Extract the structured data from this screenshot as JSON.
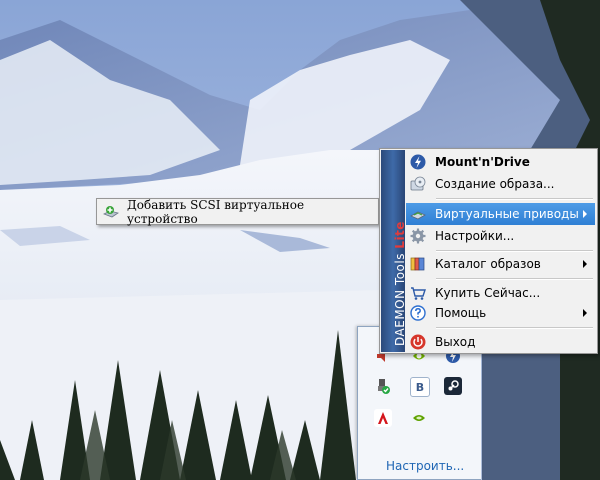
{
  "main_menu": {
    "banner": {
      "brand": "DAEMON Tools",
      "edition": "Lite"
    },
    "items": [
      {
        "label": "Mount'n'Drive",
        "icon": "lightning-icon",
        "bold": true
      },
      {
        "label": "Создание образа...",
        "icon": "disc-create-icon"
      },
      {
        "label": "Виртуальные приводы",
        "icon": "virtual-drive-icon",
        "highlighted": true,
        "submenu": true
      },
      {
        "label": "Настройки...",
        "icon": "gear-icon"
      },
      {
        "label": "Каталог образов",
        "icon": "image-catalog-icon",
        "submenu": true
      },
      {
        "label": "Купить Сейчас...",
        "icon": "shopping-cart-icon"
      },
      {
        "label": "Помощь",
        "icon": "help-icon",
        "submenu": true
      },
      {
        "label": "Выход",
        "icon": "power-icon"
      }
    ]
  },
  "submenu": {
    "items": [
      {
        "label": "Добавить SCSI виртуальное устройство",
        "icon": "add-device-icon"
      }
    ]
  },
  "tray": {
    "customize_link": "Настроить...",
    "icons": [
      "volume-icon",
      "nvidia-icon",
      "daemon-tools-icon",
      "usb-safe-remove-icon",
      "vk-icon",
      "steam-icon",
      "avira-icon",
      "nvidia-settings-icon"
    ]
  },
  "colors": {
    "highlight": "#3d8ee0",
    "banner": "#2f5288",
    "lite": "#e33b3b",
    "link": "#1f66b4"
  }
}
